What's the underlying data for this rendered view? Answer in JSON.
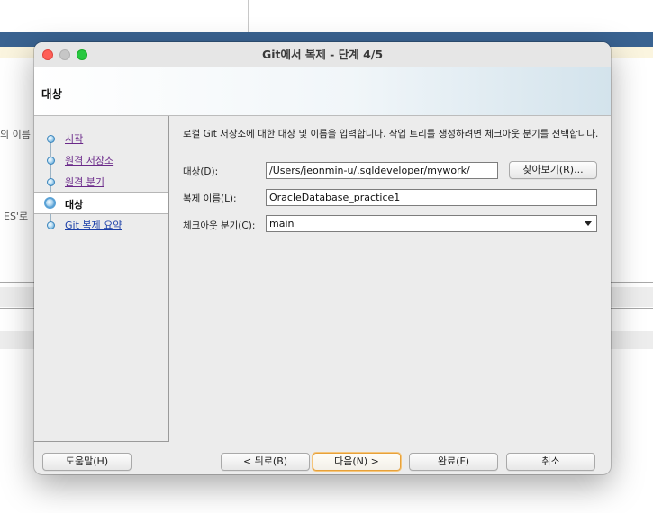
{
  "background": {
    "left_texts": [
      "의 이름",
      "ES'로"
    ]
  },
  "dialog": {
    "title": "Git에서 복제 - 단계 4/5",
    "header_title": "대상",
    "steps": [
      {
        "label": "시작",
        "state": "visited"
      },
      {
        "label": "원격 저장소",
        "state": "visited"
      },
      {
        "label": "원격 분기",
        "state": "visited"
      },
      {
        "label": "대상",
        "state": "current"
      },
      {
        "label": "Git 복제 요약",
        "state": "link"
      }
    ],
    "instruction": "로컬 Git 저장소에 대한 대상 및 이름을 입력합니다. 작업 트리를 생성하려면 체크아웃 분기를 선택합니다.",
    "fields": {
      "destination_label": "대상(D):",
      "destination_value": "/Users/jeonmin-u/.sqldeveloper/mywork/",
      "browse_label": "찾아보기(R)...",
      "clone_name_label": "복제 이름(L):",
      "clone_name_value": "OracleDatabase_practice1",
      "checkout_label": "체크아웃 분기(C):",
      "checkout_value": "main"
    },
    "buttons": {
      "help": "도움말(H)",
      "back": "< 뒤로(B)",
      "next": "다음(N) >",
      "finish": "완료(F)",
      "cancel": "취소"
    }
  }
}
